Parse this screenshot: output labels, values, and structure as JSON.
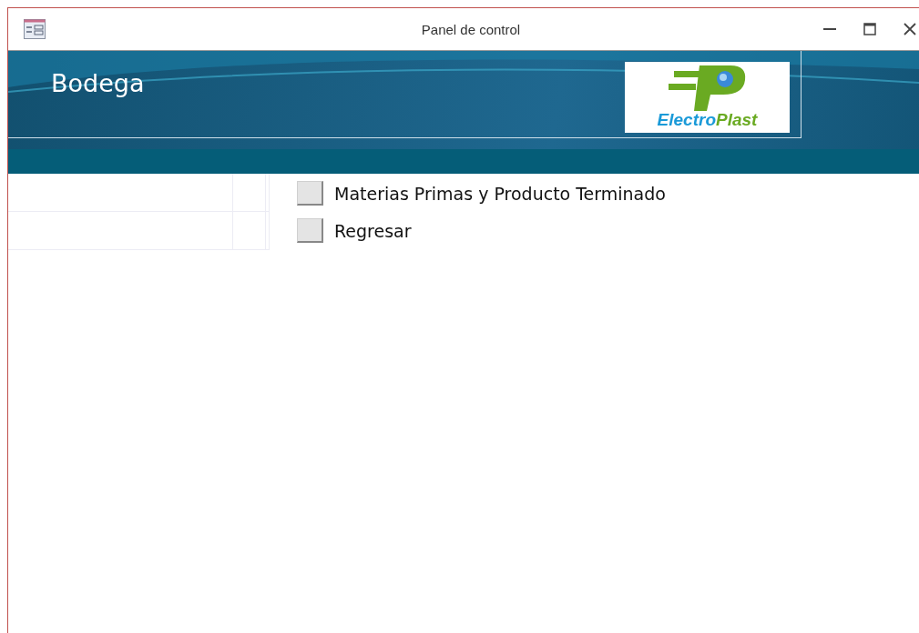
{
  "window": {
    "title": "Panel de control"
  },
  "header": {
    "title": "Bodega",
    "logo": {
      "first": "Electro",
      "second": "Plast"
    }
  },
  "menu_items": [
    {
      "label": "Materias Primas y Producto Terminado"
    },
    {
      "label": "Regresar"
    }
  ]
}
